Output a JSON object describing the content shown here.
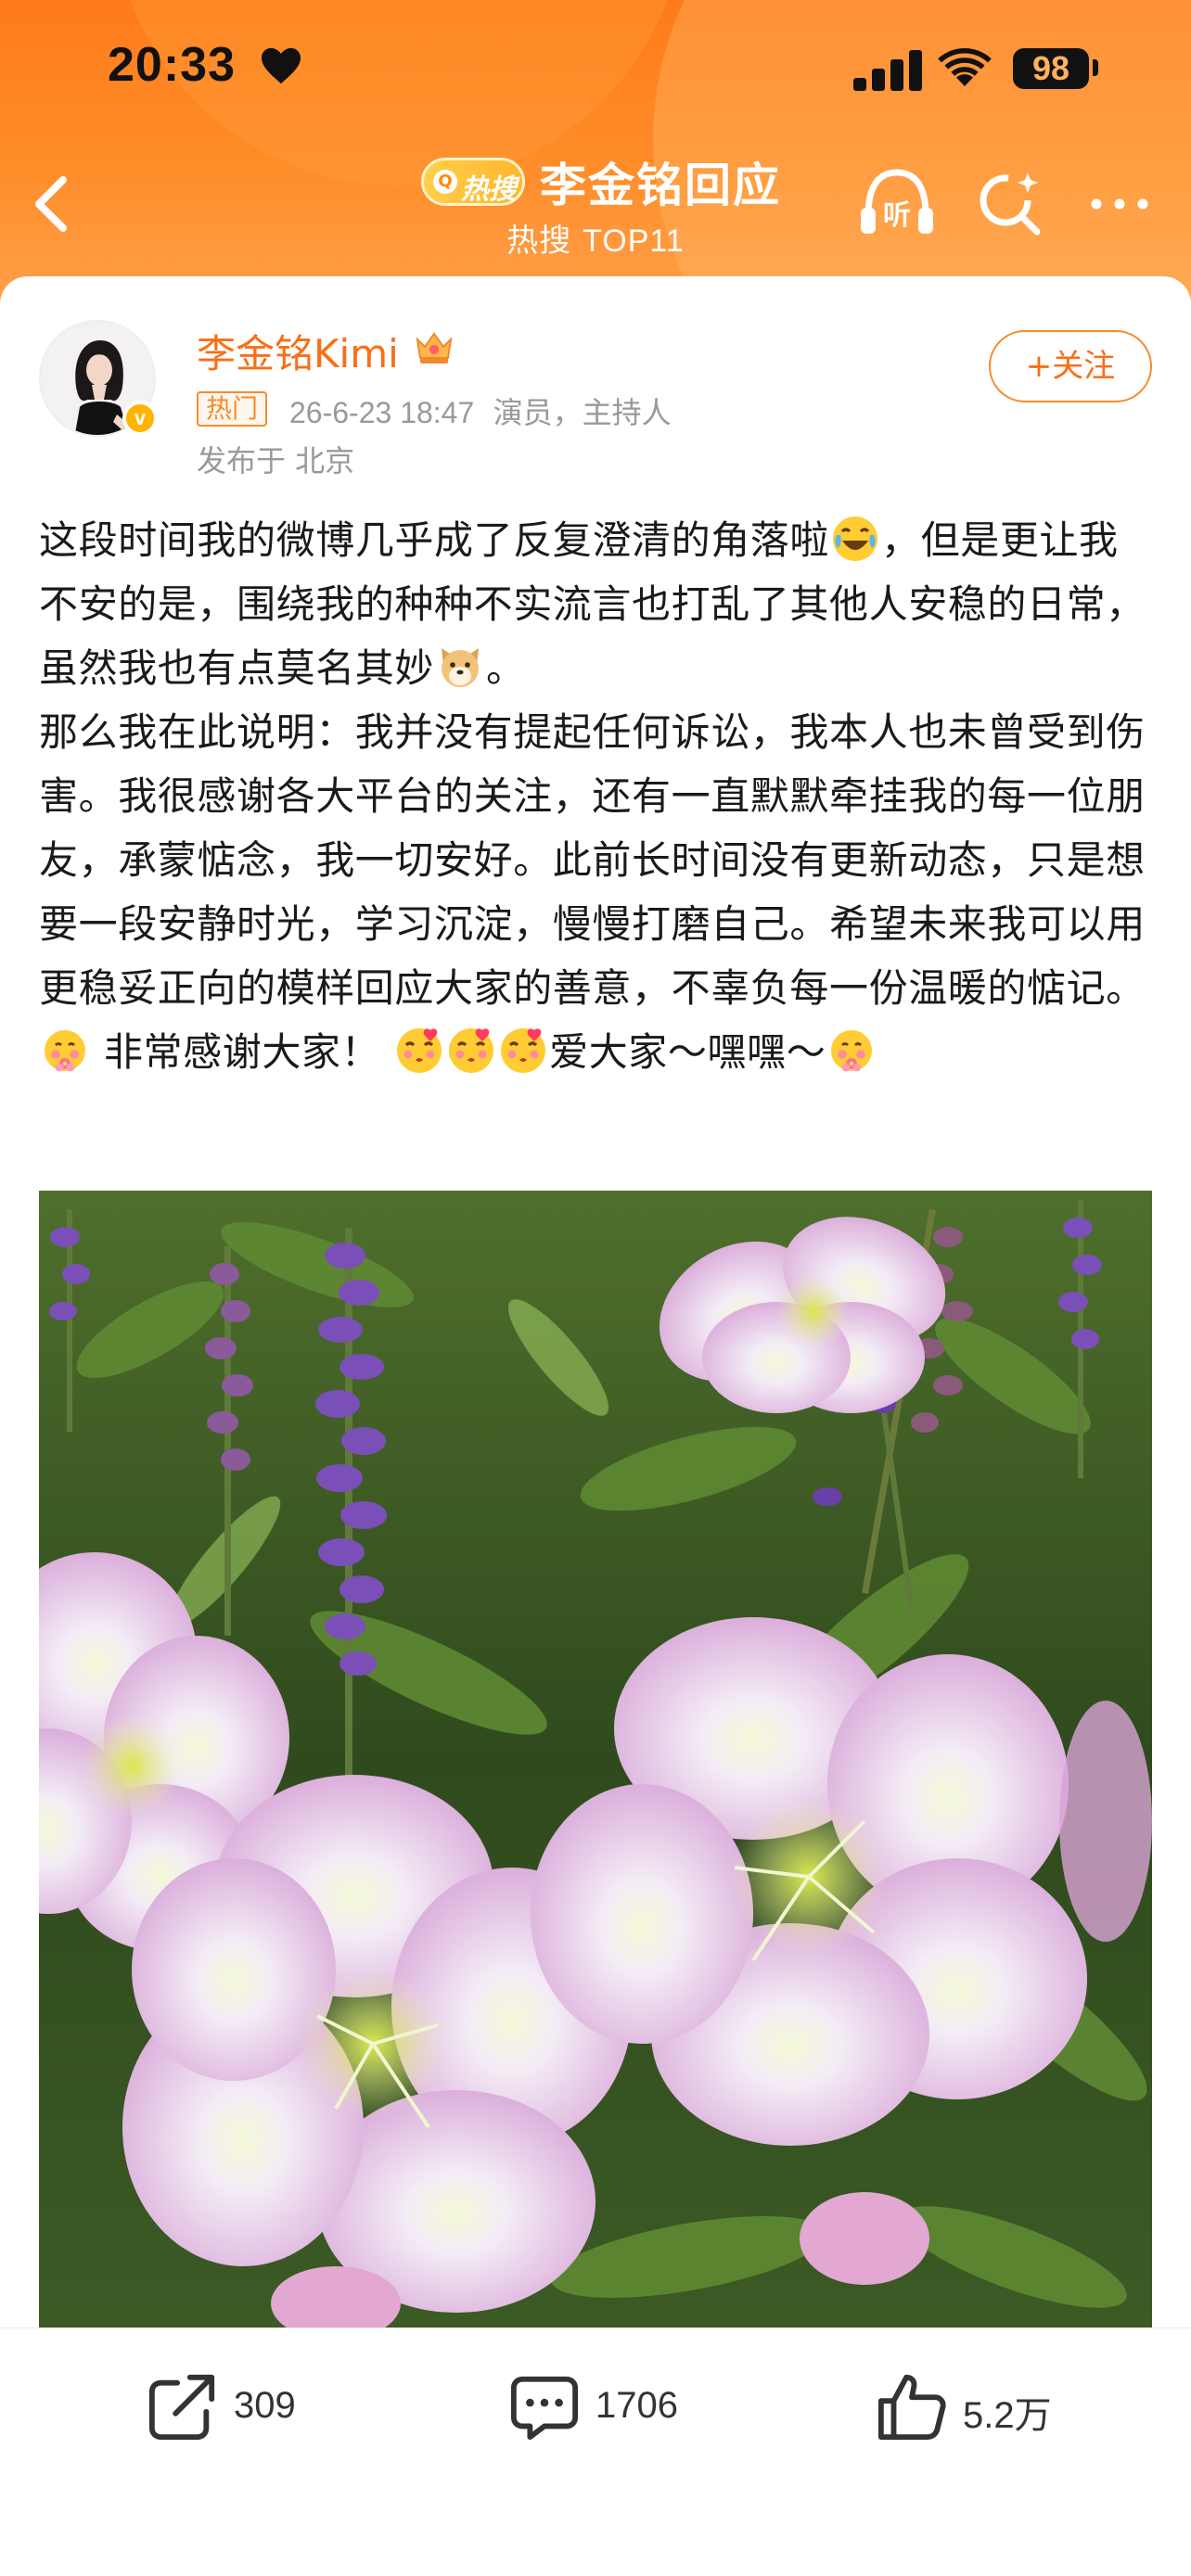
{
  "status_bar": {
    "time": "20:33",
    "battery": "98"
  },
  "nav": {
    "hot_badge": "热搜",
    "title": "李金铭回应",
    "subtitle_prefix": "热搜 ",
    "subtitle_rank": "TOP11"
  },
  "post": {
    "author": "李金铭Kimi",
    "badge": "热门",
    "timestamp": "26-6-23 18:47",
    "bio": "演员，主持人",
    "location": "发布于 北京",
    "follow_label": "+关注",
    "paragraph1_a": "这段时间我的微博几乎成了反复澄清的角落啦",
    "paragraph1_b": "，但是更让我不安的是，围绕我的种种不实流言也打乱了其他人安稳的日常，虽然我也有点莫名其妙",
    "paragraph1_c": "。",
    "paragraph2_a": "那么我在此说明：我并没有提起任何诉讼，我本人也未曾受到伤害。我很感谢各大平台的关注，还有一直默默牵挂我的每一位朋友，承蒙惦念，我一切安好。此前长时间没有更新动态，只是想要一段安静时光，学习沉淀，慢慢打磨自己。希望未来我可以用更稳妥正向的模样回应大家的善意，不辜负每一份温暖的惦记。",
    "paragraph2_b": " 非常感谢大家！",
    "paragraph2_c": "爱大家～嘿嘿～"
  },
  "actions": {
    "repost_count": "309",
    "comment_count": "1706",
    "like_count": "5.2万"
  },
  "icons": {
    "heart": "heart-icon",
    "signal": "cellular-signal-icon",
    "wifi": "wifi-icon",
    "back": "chevron-left-icon",
    "listen": "headphones-listen-icon",
    "search": "search-sparkle-icon",
    "more": "more-dots-icon",
    "repost": "share-arrow-icon",
    "comment": "comment-bubble-icon",
    "like": "thumbs-up-icon"
  },
  "colors": {
    "header_orange": "#ff7a1a",
    "accent_orange": "#f86f16",
    "meta_gray": "#999999"
  }
}
